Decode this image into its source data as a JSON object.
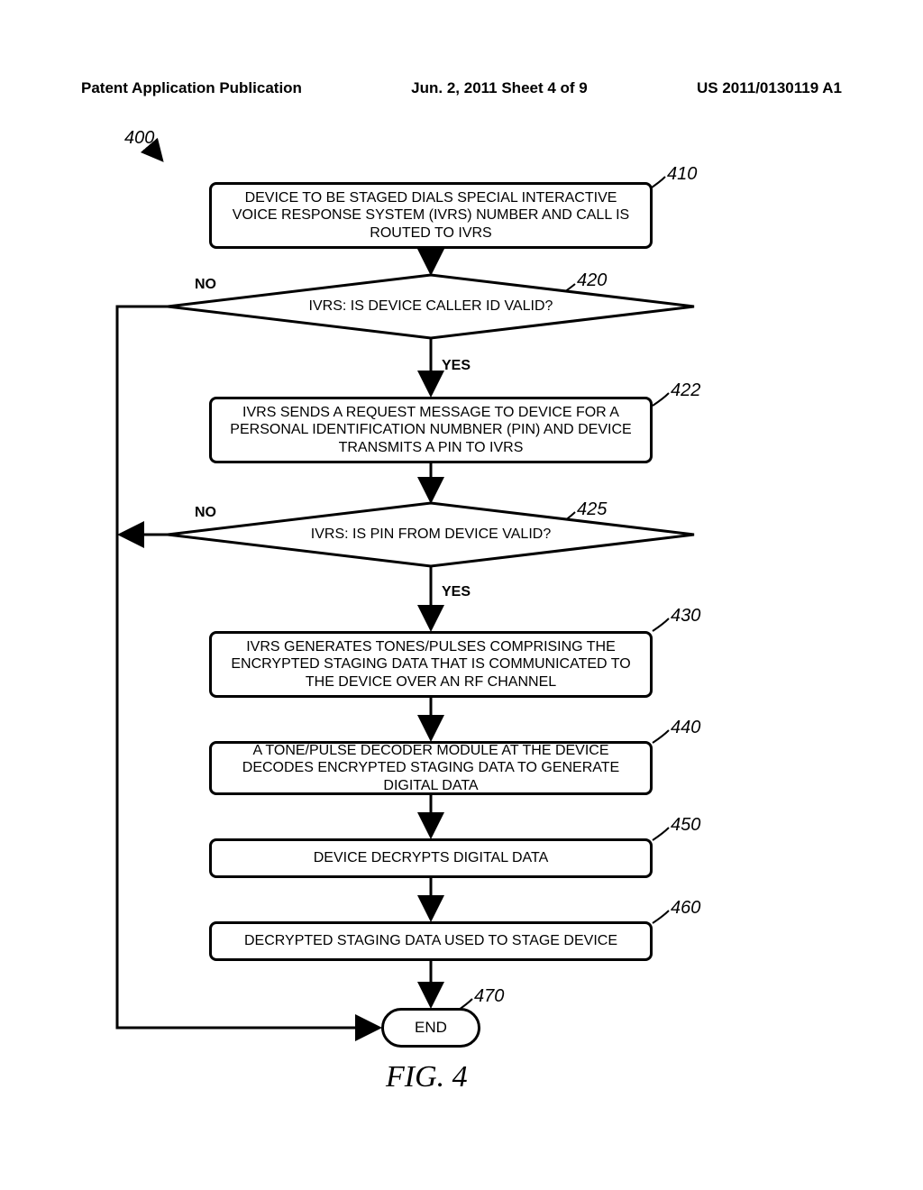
{
  "header": {
    "left": "Patent Application Publication",
    "center": "Jun. 2, 2011  Sheet 4 of 9",
    "right": "US 2011/0130119 A1"
  },
  "refs": {
    "r400": "400",
    "r410": "410",
    "r420": "420",
    "r422": "422",
    "r425": "425",
    "r430": "430",
    "r440": "440",
    "r450": "450",
    "r460": "460",
    "r470": "470"
  },
  "labels": {
    "no": "NO",
    "yes": "YES",
    "end": "END"
  },
  "boxes": {
    "b410": "DEVICE TO BE STAGED DIALS SPECIAL INTERACTIVE VOICE RESPONSE SYSTEM (IVRS) NUMBER AND CALL IS ROUTED TO IVRS",
    "d420": "IVRS: IS DEVICE CALLER ID VALID?",
    "b422": "IVRS SENDS A REQUEST MESSAGE TO DEVICE FOR A PERSONAL IDENTIFICATION NUMBNER (PIN) AND DEVICE TRANSMITS A PIN TO IVRS",
    "d425": "IVRS: IS PIN FROM DEVICE VALID?",
    "b430": "IVRS GENERATES TONES/PULSES COMPRISING THE ENCRYPTED STAGING DATA THAT IS COMMUNICATED TO THE DEVICE OVER AN RF CHANNEL",
    "b440": "A TONE/PULSE DECODER MODULE AT THE DEVICE DECODES ENCRYPTED STAGING DATA TO GENERATE DIGITAL DATA",
    "b450": "DEVICE DECRYPTS DIGITAL DATA",
    "b460": "DECRYPTED STAGING DATA USED TO STAGE DEVICE"
  },
  "caption": "FIG. 4"
}
